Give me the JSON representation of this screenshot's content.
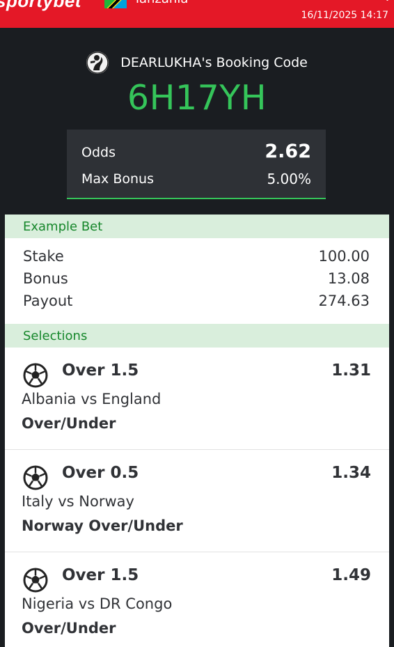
{
  "topbar": {
    "brand": "sportybet",
    "country": "Tanzania",
    "datetime": "16/11/2025 14:17"
  },
  "header": {
    "booking_label": "DEARLUKHA's Booking Code",
    "code": "6H17YH"
  },
  "summary": {
    "odds_label": "Odds",
    "odds_value": "2.62",
    "bonus_label": "Max Bonus",
    "bonus_value": "5.00%"
  },
  "example_bet": {
    "title": "Example Bet",
    "rows": [
      {
        "label": "Stake",
        "value": "100.00"
      },
      {
        "label": "Bonus",
        "value": "13.08"
      },
      {
        "label": "Payout",
        "value": "274.63"
      }
    ]
  },
  "selections": {
    "title": "Selections",
    "items": [
      {
        "icon": "soccer-ball-icon",
        "market": "Over 1.5",
        "odds": "1.31",
        "match": "Albania vs England",
        "type": "Over/Under"
      },
      {
        "icon": "soccer-ball-icon",
        "market": "Over 0.5",
        "odds": "1.34",
        "match": "Italy vs Norway",
        "type": "Norway Over/Under"
      },
      {
        "icon": "soccer-ball-icon",
        "market": "Over 1.5",
        "odds": "1.49",
        "match": "Nigeria vs DR Congo",
        "type": "Over/Under"
      }
    ]
  },
  "colors": {
    "brand_red": "#e41827",
    "accent_green": "#35c55a",
    "section_bg": "#d9eedc",
    "section_text": "#16872b",
    "dark_bg": "#1a1d21"
  }
}
